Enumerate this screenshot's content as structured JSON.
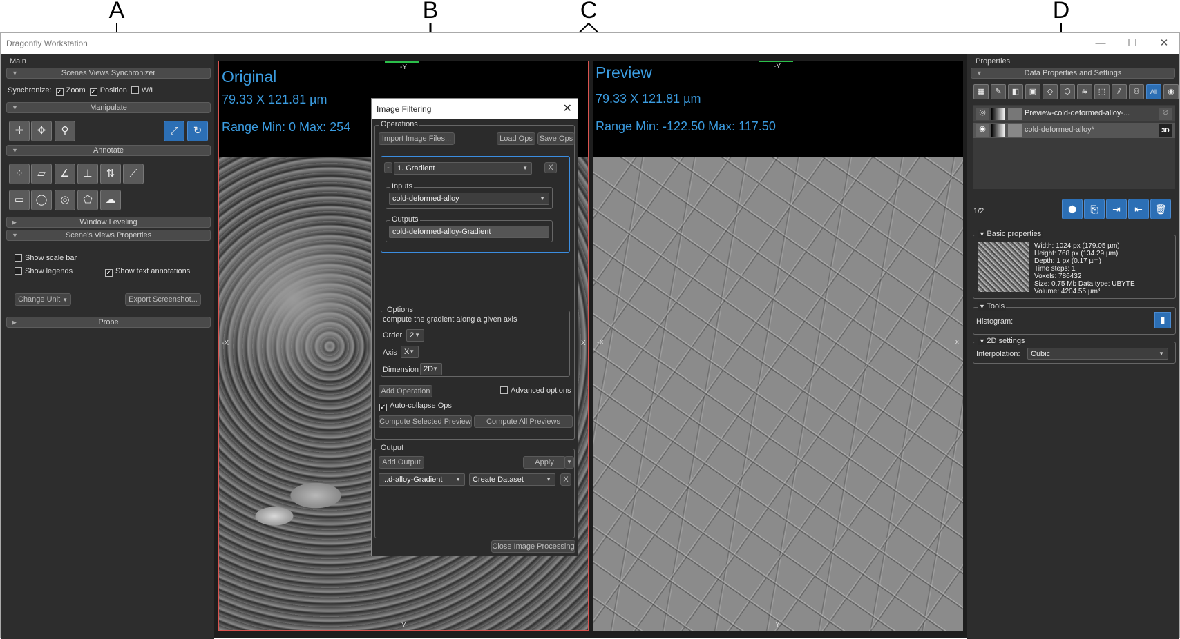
{
  "annotations": {
    "a": "A",
    "b": "B",
    "c": "C",
    "d": "D"
  },
  "window": {
    "title": "Dragonfly Workstation",
    "minimize": "—",
    "maximize": "☐",
    "close": "✕"
  },
  "left": {
    "panel_label": "Main",
    "sync_bar": "Scenes Views Synchronizer",
    "sync_label": "Synchronize:",
    "zoom": "Zoom",
    "position": "Position",
    "wl": "W/L",
    "manipulate_bar": "Manipulate",
    "annotate_bar": "Annotate",
    "window_leveling_bar": "Window Leveling",
    "scene_props_bar": "Scene's Views Properties",
    "show_scale_bar": "Show scale bar",
    "show_legends": "Show legends",
    "show_text_annotations": "Show text annotations",
    "change_unit": "Change Unit",
    "export_screenshot": "Export Screenshot...",
    "probe_bar": "Probe"
  },
  "original": {
    "title": "Original",
    "dims": "79.33 X 121.81 µm",
    "range": "Range Min: 0 Max: 254",
    "axis_top": "-Y",
    "axis_left": "-X",
    "axis_right": "X",
    "axis_bottom": "Y"
  },
  "preview": {
    "title": "Preview",
    "dims": "79.33 X 121.81 µm",
    "range": "Range Min: -122.50 Max: 117.50",
    "axis_top": "-Y",
    "axis_left": "-X",
    "axis_right": "X",
    "axis_bottom": "Y"
  },
  "dialog": {
    "title": "Image Filtering",
    "operations_label": "Operations",
    "import_btn": "Import Image Files...",
    "load_btn": "Load Ops",
    "save_btn": "Save Ops",
    "op_collapse": "-",
    "op_name": "1. Gradient",
    "op_remove": "X",
    "inputs_label": "Inputs",
    "input_value": "cold-deformed-alloy",
    "outputs_label": "Outputs",
    "output_value": "cold-deformed-alloy-Gradient",
    "options_label": "Options",
    "options_desc": "compute the gradient along a given axis",
    "order_label": "Order",
    "order_value": "2",
    "axis_label": "Axis",
    "axis_value": "X",
    "dimension_label": "Dimension",
    "dimension_value": "2D",
    "add_operation": "Add Operation",
    "advanced_options": "Advanced options",
    "auto_collapse": "Auto-collapse Ops",
    "compute_selected": "Compute Selected Preview",
    "compute_all": "Compute All Previews",
    "output_label": "Output",
    "add_output": "Add Output",
    "apply": "Apply",
    "output_combo": "...d-alloy-Gradient",
    "create_dataset": "Create Dataset",
    "output_remove": "X",
    "close_processing": "Close Image Processing"
  },
  "right": {
    "panel_label": "Properties",
    "data_bar": "Data Properties and Settings",
    "all_label": "All",
    "dataset_1": "Preview-cold-deformed-alloy-...",
    "dataset_2": "cold-deformed-alloy*",
    "badge_3d": "3D",
    "pager": "1/2",
    "basic_props_label": "Basic properties",
    "props": [
      "Width: 1024 px (179.05 µm)",
      "Height: 768 px (134.29 µm)",
      "Depth: 1 px (0.17 µm)",
      "Time steps: 1",
      "Voxels: 786432",
      "Size: 0.75 Mb  Data type: UBYTE",
      "Volume: 4204.55 µm³"
    ],
    "tools_label": "Tools",
    "histogram_label": "Histogram:",
    "settings_label": "2D settings",
    "interp_label": "Interpolation:",
    "interp_value": "Cubic"
  }
}
